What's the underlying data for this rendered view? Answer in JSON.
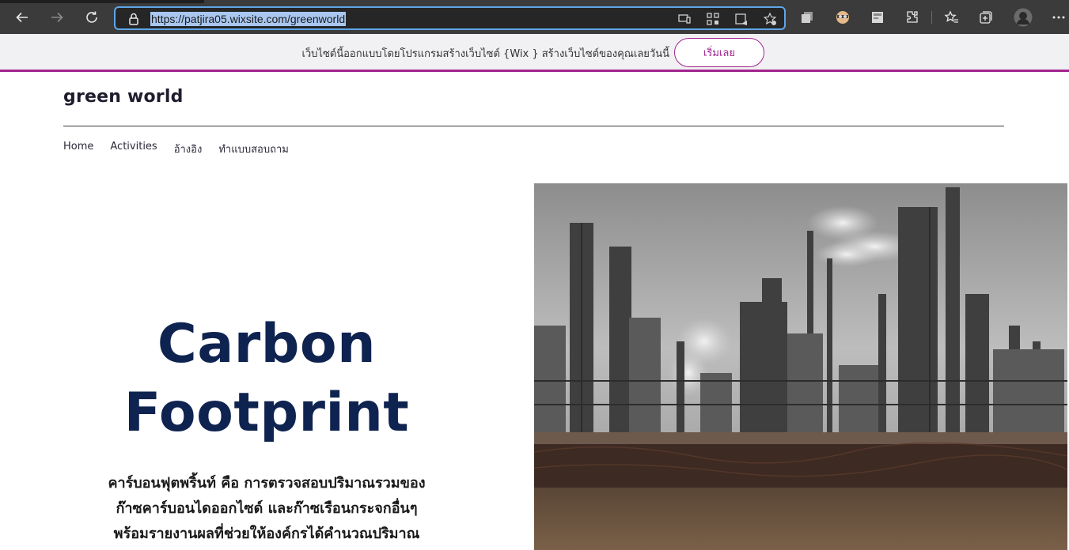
{
  "browser": {
    "url": "https://patjira05.wixsite.com/greenworld",
    "address_icons": [
      "devices-icon",
      "qr-code-icon",
      "immersive-reader-icon",
      "add-favorite-icon"
    ],
    "toolbar_icons": [
      "collections-icon",
      "profile-face-icon",
      "sticky-note-icon",
      "extensions-icon",
      "favorites-icon",
      "tab-collections-icon",
      "avatar-icon",
      "more-icon"
    ]
  },
  "wix_banner": {
    "message": "เว็บไซต์นี้ออกแบบโดยโปรแกรมสร้างเว็บไซต์ {Wix } สร้างเว็บไซต์ของคุณเลยวันนี้",
    "button_label": "เริ่มเลย",
    "accent_color": "#a1248e"
  },
  "site": {
    "title": "green world",
    "menu": [
      {
        "label": "Home"
      },
      {
        "label": "Activities"
      },
      {
        "label": "อ้างอิง"
      },
      {
        "label": "ทำแบบสอบถาม"
      }
    ]
  },
  "hero": {
    "heading_line1": "Carbon",
    "heading_line2": "Footprint",
    "heading_color": "#0f2350",
    "text_lines": [
      "คาร์บอนฟุตพริ้นท์ คือ การตรวจสอบปริมาณรวมของ",
      "ก๊าซคาร์บอนไดออกไซด์ และก๊าซเรือนกระจกอื่นๆ",
      "พร้อมรายงานผลที่ช่วยให้องค์กรได้คำนวณปริมาณ"
    ],
    "image": "industrial-plant-smokestacks-photo"
  }
}
